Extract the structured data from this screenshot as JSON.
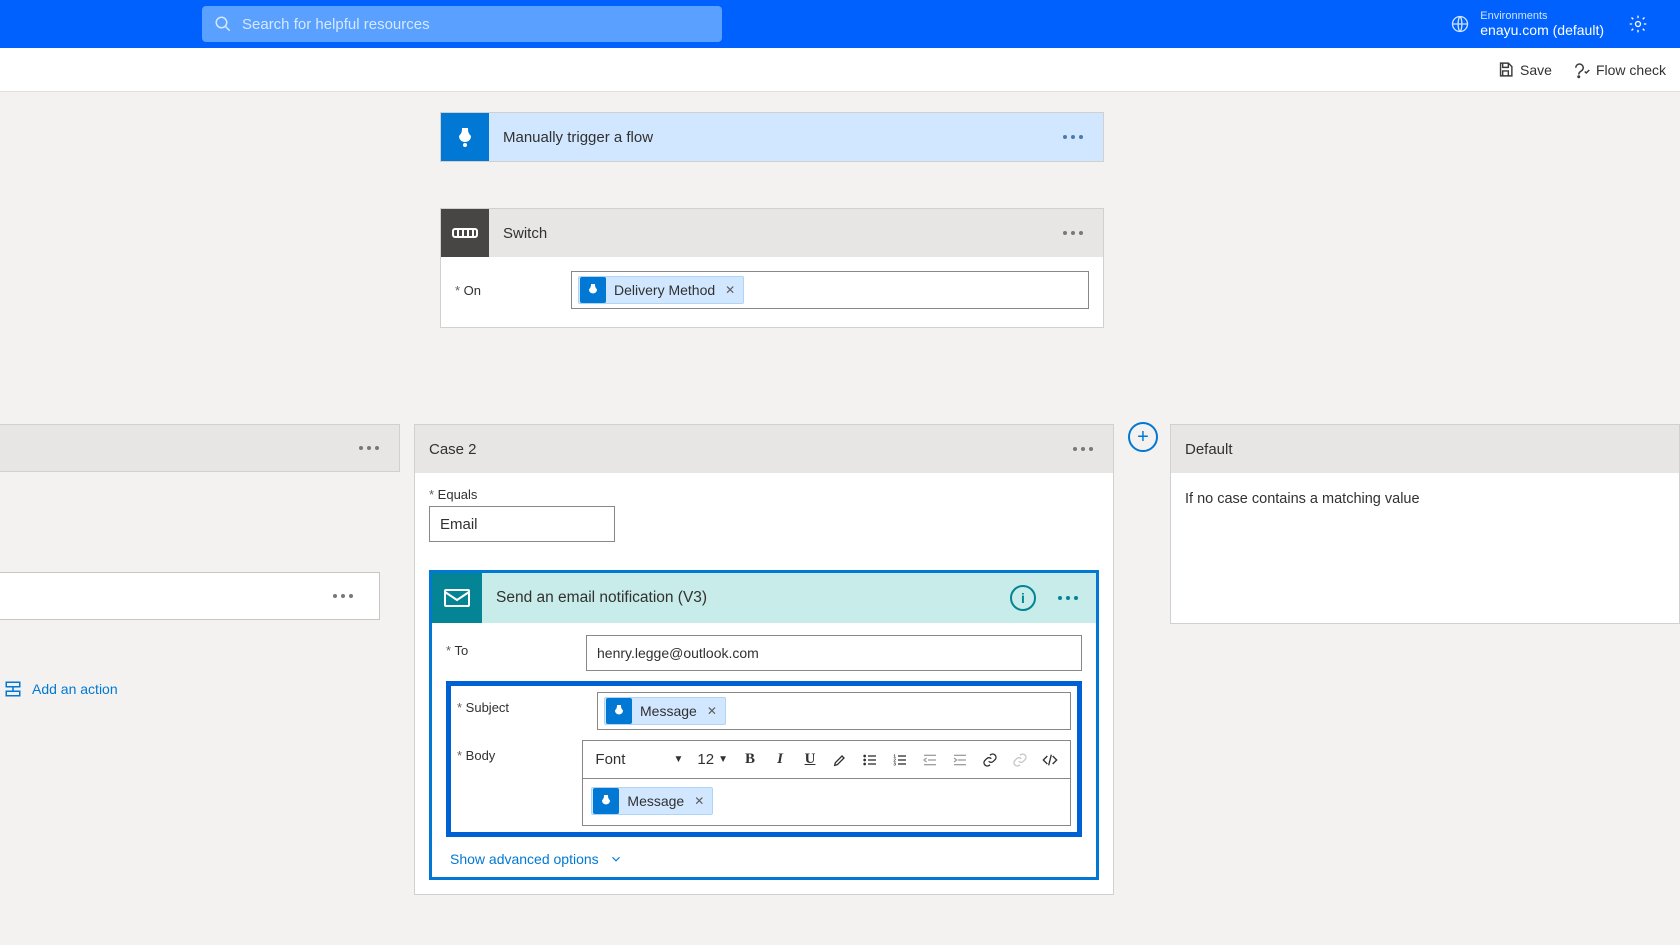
{
  "header": {
    "search_placeholder": "Search for helpful resources",
    "env_label": "Environments",
    "env_value": "enayu.com (default)"
  },
  "cmdbar": {
    "save": "Save",
    "flowcheck": "Flow check"
  },
  "trigger": {
    "title": "Manually trigger a flow"
  },
  "switch": {
    "title": "Switch",
    "on_label": "On",
    "token": "Delivery Method"
  },
  "case_left": {
    "add_action": "Add an action"
  },
  "case2": {
    "title": "Case 2",
    "equals_label": "Equals",
    "equals_value": "Email"
  },
  "email": {
    "title": "Send an email notification (V3)",
    "to_label": "To",
    "to_value": "henry.legge@outlook.com",
    "subject_label": "Subject",
    "subject_token": "Message",
    "body_label": "Body",
    "body_token": "Message",
    "font_label": "Font",
    "fontsize_label": "12",
    "advanced": "Show advanced options"
  },
  "default": {
    "title": "Default",
    "desc": "If no case contains a matching value"
  }
}
